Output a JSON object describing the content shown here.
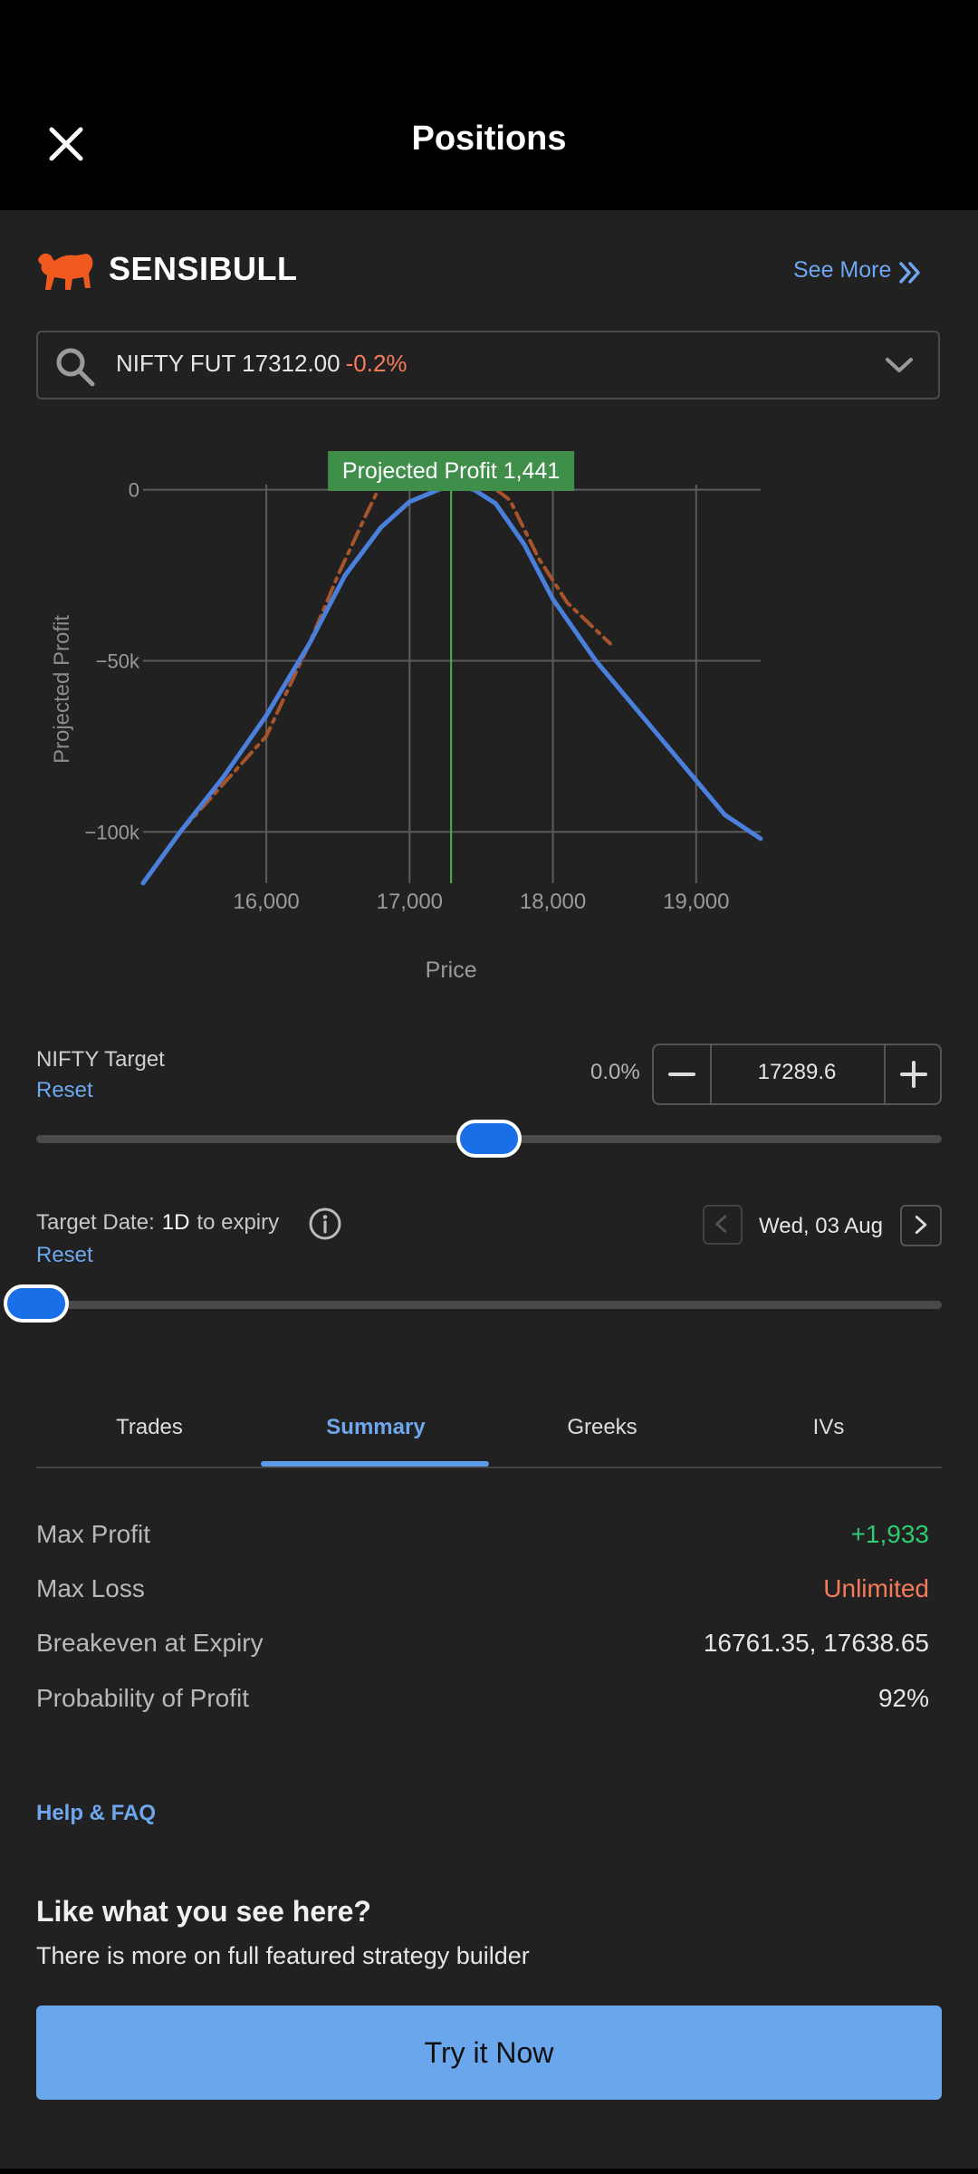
{
  "header": {
    "title": "Positions"
  },
  "brand": {
    "name": "SENSIBULL",
    "see_more": "See More"
  },
  "instrument": {
    "name": "NIFTY FUT 17312.00",
    "change": "-0.2%"
  },
  "chart_data": {
    "type": "line",
    "tag": "Projected Profit 1,441",
    "xlabel": "Price",
    "ylabel": "Projected Profit",
    "x_ticks": [
      "16,000",
      "17,000",
      "18,000",
      "19,000"
    ],
    "y_ticks": [
      "0",
      "−50k",
      "−100k"
    ],
    "xlim": [
      15140,
      19450
    ],
    "ylim": [
      -115000,
      1500
    ],
    "target_price": 17289.6,
    "series": [
      {
        "style": "solid",
        "color": "#4a7fdc",
        "x": [
          15140,
          15400,
          15700,
          16000,
          16300,
          16550,
          16800,
          17000,
          17200,
          17300,
          17450,
          17600,
          17800,
          18000,
          18300,
          18600,
          18900,
          19200,
          19450
        ],
        "y": [
          -115000,
          -100000,
          -84000,
          -66000,
          -45000,
          -25000,
          -11000,
          -3500,
          0,
          1441,
          0,
          -4000,
          -16000,
          -32000,
          -50000,
          -65000,
          -80000,
          -95000,
          -102000
        ]
      },
      {
        "style": "dashdot",
        "color": "#a8542a",
        "x": [
          15400,
          15700,
          16000,
          16300,
          16500,
          16700,
          16800,
          17000,
          17300,
          17550,
          17700,
          17900,
          18100,
          18400
        ],
        "y": [
          -100000,
          -86000,
          -72000,
          -45000,
          -25000,
          -7000,
          1600,
          1900,
          1900,
          1700,
          -3000,
          -20000,
          -33000,
          -45000
        ]
      }
    ]
  },
  "target": {
    "label": "NIFTY Target",
    "reset": "Reset",
    "pct": "0.0%",
    "value": "17289.6",
    "slider_fraction": 0.5
  },
  "target_date": {
    "label": "Target Date:",
    "days": "1D",
    "suffix": "to expiry",
    "reset": "Reset",
    "date": "Wed, 03 Aug",
    "slider_fraction": 0.0
  },
  "tabs": [
    "Trades",
    "Summary",
    "Greeks",
    "IVs"
  ],
  "summary": [
    {
      "label": "Max Profit",
      "value": "+1,933"
    },
    {
      "label": "Max Loss",
      "value": "Unlimited"
    },
    {
      "label": "Breakeven at Expiry",
      "value": "16761.35, 17638.65"
    },
    {
      "label": "Probability of Profit",
      "value": "92%"
    }
  ],
  "help": "Help & FAQ",
  "promo": {
    "title": "Like what you see here?",
    "subtitle": "There is more on full featured strategy builder",
    "cta": "Try it Now"
  },
  "colors": {
    "accent": "#6ea7ee",
    "profit": "#2ecc71",
    "loss": "#f57b5a",
    "background": "#212121",
    "topbar": "#000000"
  }
}
